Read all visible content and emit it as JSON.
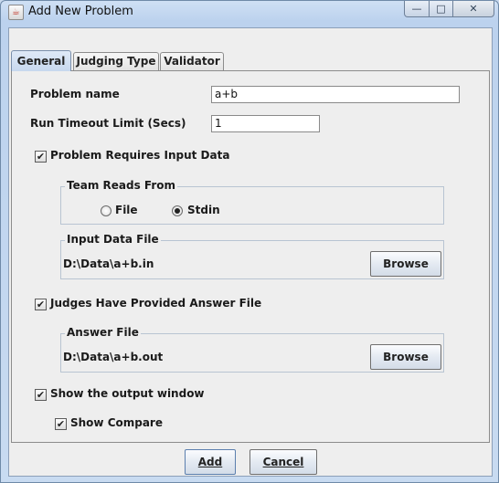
{
  "window": {
    "title": "Add New Problem",
    "icon": "java-cup-icon",
    "controls": {
      "minimize": "—",
      "maximize": "□",
      "close": "✕"
    }
  },
  "tabs": [
    {
      "label": "General",
      "active": true
    },
    {
      "label": "Judging Type",
      "active": false
    },
    {
      "label": "Validator",
      "active": false
    }
  ],
  "general": {
    "problem_name_label": "Problem name",
    "problem_name_value": "a+b",
    "timeout_label": "Run Timeout Limit (Secs)",
    "timeout_value": "1",
    "requires_input": {
      "label": "Problem Requires Input Data",
      "checked": true
    },
    "team_reads_from": {
      "title": "Team Reads From",
      "options": [
        {
          "label": "File",
          "selected": false
        },
        {
          "label": "Stdin",
          "selected": true
        }
      ]
    },
    "input_data_file": {
      "title": "Input Data File",
      "path": "D:\\Data\\a+b.in",
      "browse_label": "Browse"
    },
    "judges_answer": {
      "label": "Judges Have Provided Answer File",
      "checked": true
    },
    "answer_file": {
      "title": "Answer File",
      "path": "D:\\Data\\a+b.out",
      "browse_label": "Browse"
    },
    "show_output": {
      "label": "Show the output window",
      "checked": true
    },
    "show_compare": {
      "label": "Show Compare",
      "checked": true
    }
  },
  "footer": {
    "add_label": "Add",
    "cancel_label": "Cancel"
  },
  "colors": {
    "titlebar": "#c9d9ee",
    "panel": "#eeeeee",
    "tab_active": "#c7d8ee"
  }
}
